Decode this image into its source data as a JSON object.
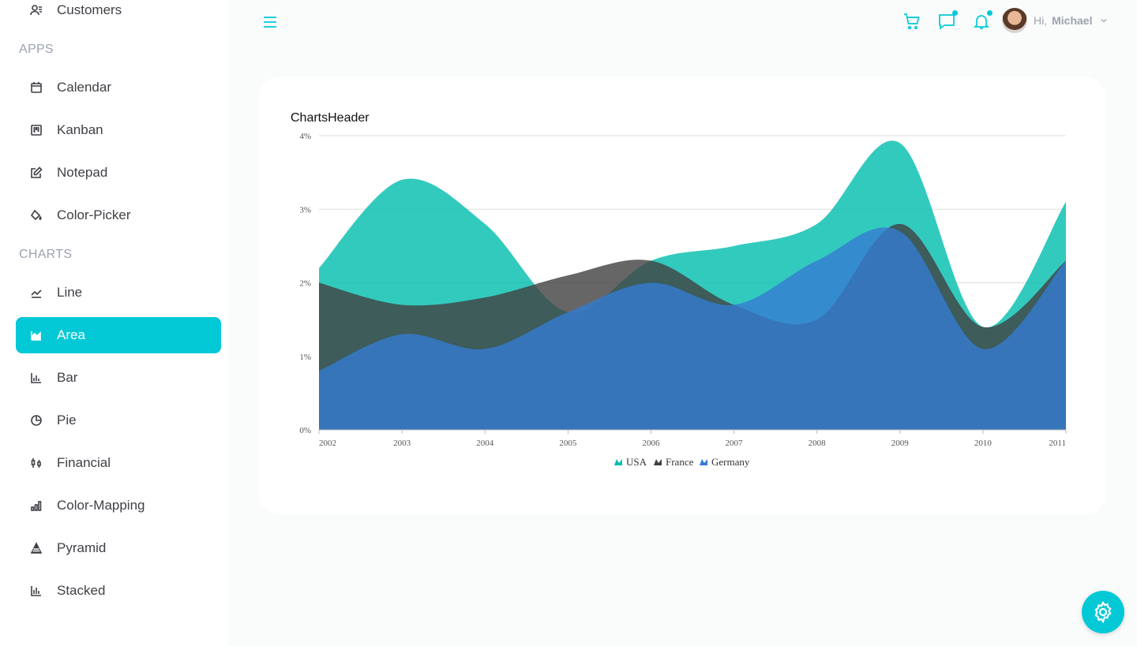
{
  "sidebar": {
    "customers": "Customers",
    "apps_section": "APPS",
    "calendar": "Calendar",
    "kanban": "Kanban",
    "notepad": "Notepad",
    "color_picker": "Color-Picker",
    "charts_section": "CHARTS",
    "line": "Line",
    "area": "Area",
    "bar": "Bar",
    "pie": "Pie",
    "financial": "Financial",
    "color_mapping": "Color-Mapping",
    "pyramid": "Pyramid",
    "stacked": "Stacked"
  },
  "header": {
    "greeting": "Hi,",
    "user_name": "Michael",
    "icons": [
      "menu-icon",
      "cart-icon",
      "chat-icon",
      "bell-icon",
      "chevron-down-icon"
    ]
  },
  "colors": {
    "accent": "#03c9d7",
    "usa": "#00bdae",
    "france": "#404041",
    "germany": "#357cd2"
  },
  "chart_data": {
    "type": "area",
    "title": "ChartsHeader",
    "x": [
      "2002",
      "2003",
      "2004",
      "2005",
      "2006",
      "2007",
      "2008",
      "2009",
      "2010",
      "2011"
    ],
    "ylim": [
      0,
      4
    ],
    "yticks": [
      "0%",
      "1%",
      "2%",
      "3%",
      "4%"
    ],
    "grid": true,
    "legend_position": "bottom",
    "series": [
      {
        "name": "USA",
        "values": [
          2.2,
          3.4,
          2.8,
          1.6,
          2.3,
          2.5,
          2.8,
          3.9,
          1.4,
          3.1
        ]
      },
      {
        "name": "France",
        "values": [
          2.0,
          1.7,
          1.8,
          2.1,
          2.3,
          1.7,
          1.5,
          2.8,
          1.4,
          2.3
        ]
      },
      {
        "name": "Germany",
        "values": [
          0.8,
          1.3,
          1.1,
          1.6,
          2.0,
          1.7,
          2.3,
          2.7,
          1.1,
          2.3
        ]
      }
    ]
  }
}
